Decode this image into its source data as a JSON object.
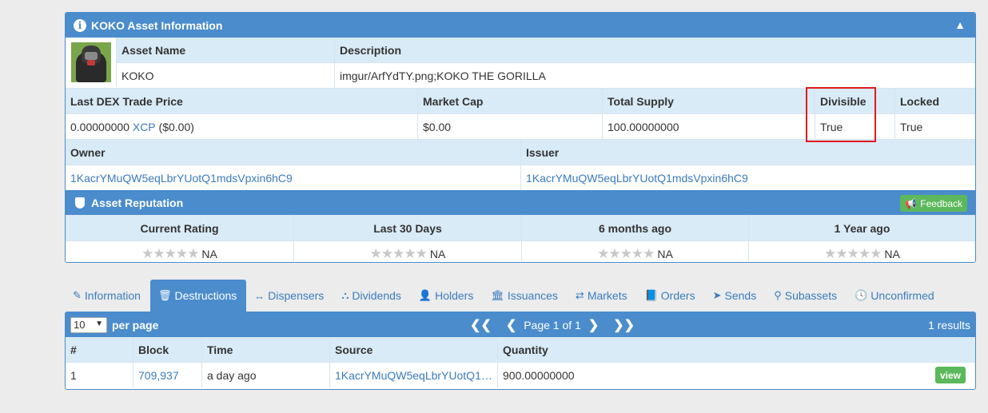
{
  "asset_panel": {
    "title": "KOKO Asset Information",
    "collapse_icon": "chevron-up-icon",
    "asset_name_label": "Asset Name",
    "description_label": "Description",
    "asset_name": "KOKO",
    "description": "imgur/ArfYdTY.png;KOKO THE GORILLA",
    "last_price_label": "Last DEX Trade Price",
    "market_cap_label": "Market Cap",
    "total_supply_label": "Total Supply",
    "divisible_label": "Divisible",
    "locked_label": "Locked",
    "last_price_value": "0.00000000",
    "last_price_currency": "XCP",
    "last_price_usd": "($0.00)",
    "market_cap": "$0.00",
    "total_supply": "100.00000000",
    "divisible": "True",
    "locked": "True",
    "owner_label": "Owner",
    "issuer_label": "Issuer",
    "owner": "1KacrYMuQW5eqLbrYUotQ1mdsVpxin6hC9",
    "issuer": "1KacrYMuQW5eqLbrYUotQ1mdsVpxin6hC9"
  },
  "reputation": {
    "title": "Asset Reputation",
    "feedback_label": "Feedback",
    "columns": [
      {
        "label": "Current Rating",
        "value": "NA"
      },
      {
        "label": "Last 30 Days",
        "value": "NA"
      },
      {
        "label": "6 months ago",
        "value": "NA"
      },
      {
        "label": "1 Year ago",
        "value": "NA"
      }
    ],
    "stars_text": "★★★★★"
  },
  "tabs": [
    {
      "label": "Information",
      "icon": "pencil-icon",
      "glyph": "✎"
    },
    {
      "label": "Destructions",
      "icon": "trash-icon",
      "glyph": "🗑"
    },
    {
      "label": "Dispensers",
      "icon": "arrows-horizontal-icon",
      "glyph": "↔"
    },
    {
      "label": "Dividends",
      "icon": "sitemap-icon",
      "glyph": "⛬"
    },
    {
      "label": "Holders",
      "icon": "user-icon",
      "glyph": "👤"
    },
    {
      "label": "Issuances",
      "icon": "bank-icon",
      "glyph": "🏛"
    },
    {
      "label": "Markets",
      "icon": "exchange-icon",
      "glyph": "⇄"
    },
    {
      "label": "Orders",
      "icon": "book-icon",
      "glyph": "📘"
    },
    {
      "label": "Sends",
      "icon": "paper-plane-icon",
      "glyph": "➤"
    },
    {
      "label": "Subassets",
      "icon": "child-icon",
      "glyph": "⚲"
    },
    {
      "label": "Unconfirmed",
      "icon": "clock-icon",
      "glyph": "🕓"
    }
  ],
  "destructions": {
    "per_page_value": "10",
    "per_page_label": "per page",
    "first_glyph": "❮❮",
    "prev_glyph": "❮",
    "next_glyph": "❯",
    "last_glyph": "❯❯",
    "page_text": "Page 1 of 1",
    "results_text": "1 results",
    "columns": [
      "#",
      "Block",
      "Time",
      "Source",
      "Quantity"
    ],
    "rows": [
      {
        "num": "1",
        "block": "709,937",
        "time": "a day ago",
        "source": "1KacrYMuQW5eqLbrYUotQ1…",
        "quantity": "900.00000000",
        "action": "view"
      }
    ]
  }
}
